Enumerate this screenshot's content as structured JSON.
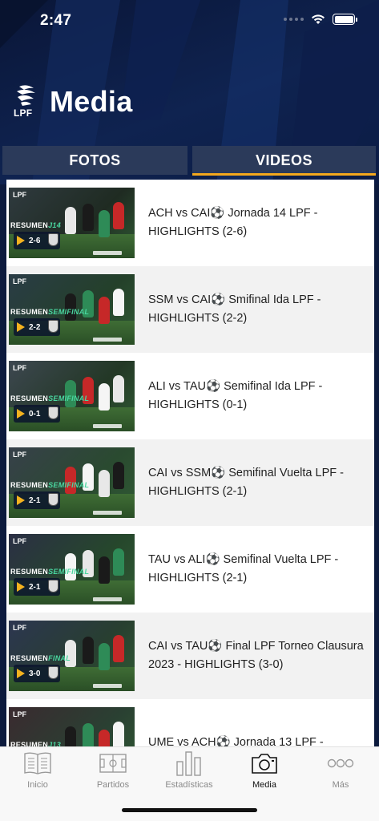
{
  "status_bar": {
    "time": "2:47"
  },
  "header": {
    "logo_text": "LPF",
    "title": "Media"
  },
  "tabs": [
    {
      "label": "FOTOS",
      "active": false
    },
    {
      "label": "VIDEOS",
      "active": true
    }
  ],
  "videos": [
    {
      "title": "ACH vs CAI⚽ Jornada 14 LPF - HIGHLIGHTS (2-6)",
      "thumb_score": "2-6",
      "thumb_tag": "J14"
    },
    {
      "title": "SSM vs CAI⚽ Smifinal Ida LPF - HIGHLIGHTS (2-2)",
      "thumb_score": "2-2",
      "thumb_tag": "SEMIFINAL"
    },
    {
      "title": "ALI vs TAU⚽ Semifinal Ida LPF - HIGHLIGHTS (0-1)",
      "thumb_score": "0-1",
      "thumb_tag": "SEMIFINAL"
    },
    {
      "title": "CAI vs SSM⚽ Semifinal Vuelta LPF - HIGHLIGHTS (2-1)",
      "thumb_score": "2-1",
      "thumb_tag": "SEMIFINAL"
    },
    {
      "title": "TAU vs ALI⚽ Semifinal Vuelta LPF - HIGHLIGHTS (2-1)",
      "thumb_score": "2-1",
      "thumb_tag": "SEMIFINAL"
    },
    {
      "title": "CAI vs TAU⚽ Final LPF Torneo Clausura 2023 - HIGHLIGHTS (3-0)",
      "thumb_score": "3-0",
      "thumb_tag": "FINAL"
    },
    {
      "title": "UME vs ACH⚽ Jornada 13 LPF -",
      "thumb_score": "",
      "thumb_tag": "J13"
    }
  ],
  "thumb_common": {
    "logo": "LPF",
    "resumen": "RESUMEN"
  },
  "tabbar": [
    {
      "label": "Inicio",
      "icon": "book-icon",
      "active": false
    },
    {
      "label": "Partidos",
      "icon": "field-icon",
      "active": false
    },
    {
      "label": "Estadísticas",
      "icon": "bars-icon",
      "active": false
    },
    {
      "label": "Media",
      "icon": "camera-icon",
      "active": true
    },
    {
      "label": "Más",
      "icon": "more-dots-icon",
      "active": false
    }
  ],
  "colors": {
    "accent": "#f4a81c",
    "header_bg": "#0f2350",
    "tab_bg": "#2b3a5a"
  }
}
